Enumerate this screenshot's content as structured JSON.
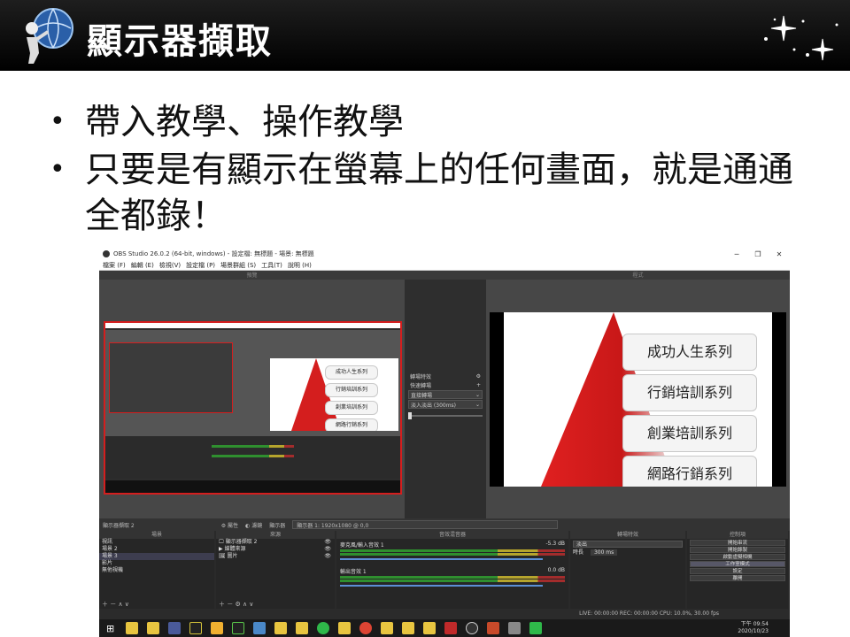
{
  "slide": {
    "title": "顯示器擷取",
    "bullets": [
      "帶入教學、操作教學",
      "只要是有顯示在螢幕上的任何畫面，就是通通全都錄！"
    ]
  },
  "obs": {
    "window_title": "OBS Studio 26.0.2 (64-bit, windows) - 設定檔: 無標題 - 場景: 無標題",
    "window_buttons": [
      "─",
      "❐",
      "✕"
    ],
    "menu": [
      "檔案 (F)",
      "編輯 (E)",
      "檢視(V)",
      "設定檔 (P)",
      "場景群組 (S)",
      "工具(T)",
      "說明 (H)"
    ],
    "preview_label": "預覽",
    "program_label": "程式",
    "slide_items": [
      "成功人生系列",
      "行銷培訓系列",
      "創業培訓系列",
      "網路行銷系列"
    ],
    "transition_panel": {
      "title": "轉場特效",
      "quick": "快速轉場",
      "mode": "直接轉場",
      "fade": "淡入淡出 (300ms)"
    },
    "source_toolbar": {
      "source_name": "顯示器擷取 2",
      "properties": "屬性",
      "filters": "濾鏡",
      "display_label": "顯示器",
      "display_value": "顯示器 1: 1920x1080 @ 0,0"
    },
    "scenes": {
      "title": "場景",
      "items": [
        "視訊",
        "場景 2",
        "場景 3",
        "影片",
        "無他視機"
      ],
      "selected": 2,
      "footer": "＋ －  ∧ ∨"
    },
    "sources": {
      "title": "來源",
      "items": [
        "顯示器擷取 2",
        "媒體來源",
        "圖片"
      ],
      "footer": "＋ － ⚙ ∧ ∨"
    },
    "mixer": {
      "title": "音效混音器",
      "tracks": [
        {
          "name": "麥克風/輸入音效 1",
          "db": "-5.3 dB"
        },
        {
          "name": "輸出音效 1",
          "db": "0.0 dB"
        }
      ]
    },
    "transitions_dock": {
      "title": "轉場特效",
      "type": "淡出",
      "duration_label": "時長",
      "duration_value": "300 ms"
    },
    "controls": {
      "title": "控制項",
      "buttons": [
        "開始串流",
        "開始錄製",
        "啟動虛擬相機",
        "工作室模式",
        "設定",
        "離開"
      ],
      "active": 3
    },
    "status": "LIVE: 00:00:00 REC: 00:00:00 CPU: 10.0%, 30.00 fps",
    "clock": {
      "time": "下午 09:54",
      "date": "2020/10/23"
    }
  },
  "colors": {
    "accent_red": "#d41e1e",
    "obs_bg": "#2b2b2b",
    "slide_header": "#000000"
  },
  "icons": [
    "globe-logo-icon",
    "sparkle-stars-icon",
    "gear-icon",
    "windows-start-icon"
  ]
}
